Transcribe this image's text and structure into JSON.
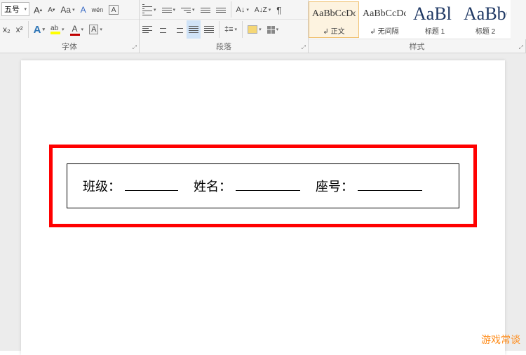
{
  "ribbon": {
    "font": {
      "size_value": "五号",
      "grow_label": "A",
      "shrink_label": "A",
      "case_label": "Aa",
      "clear_label": "A",
      "phonetic_label": "wén",
      "charborder_label": "A",
      "sub_label": "x₂",
      "sup_label": "x²",
      "effects_label": "A",
      "highlight_label": "",
      "color_label": "A",
      "shade_label": "A",
      "group_name": "字体"
    },
    "paragraph": {
      "group_name": "段落"
    },
    "styles": {
      "group_name": "样式",
      "items": [
        {
          "preview": "AaBbCcDc",
          "name": "↲ 正文",
          "selected": true,
          "large": false
        },
        {
          "preview": "AaBbCcDc",
          "name": "↲ 无间隔",
          "selected": false,
          "large": false
        },
        {
          "preview": "AaBl",
          "name": "标题 1",
          "selected": false,
          "large": true
        },
        {
          "preview": "AaBbC",
          "name": "标题 2",
          "selected": false,
          "large": true
        }
      ]
    }
  },
  "document": {
    "field1_label": "班级：",
    "field2_label": "姓名：",
    "field3_label": "座号："
  },
  "watermark": "游戏常谈"
}
